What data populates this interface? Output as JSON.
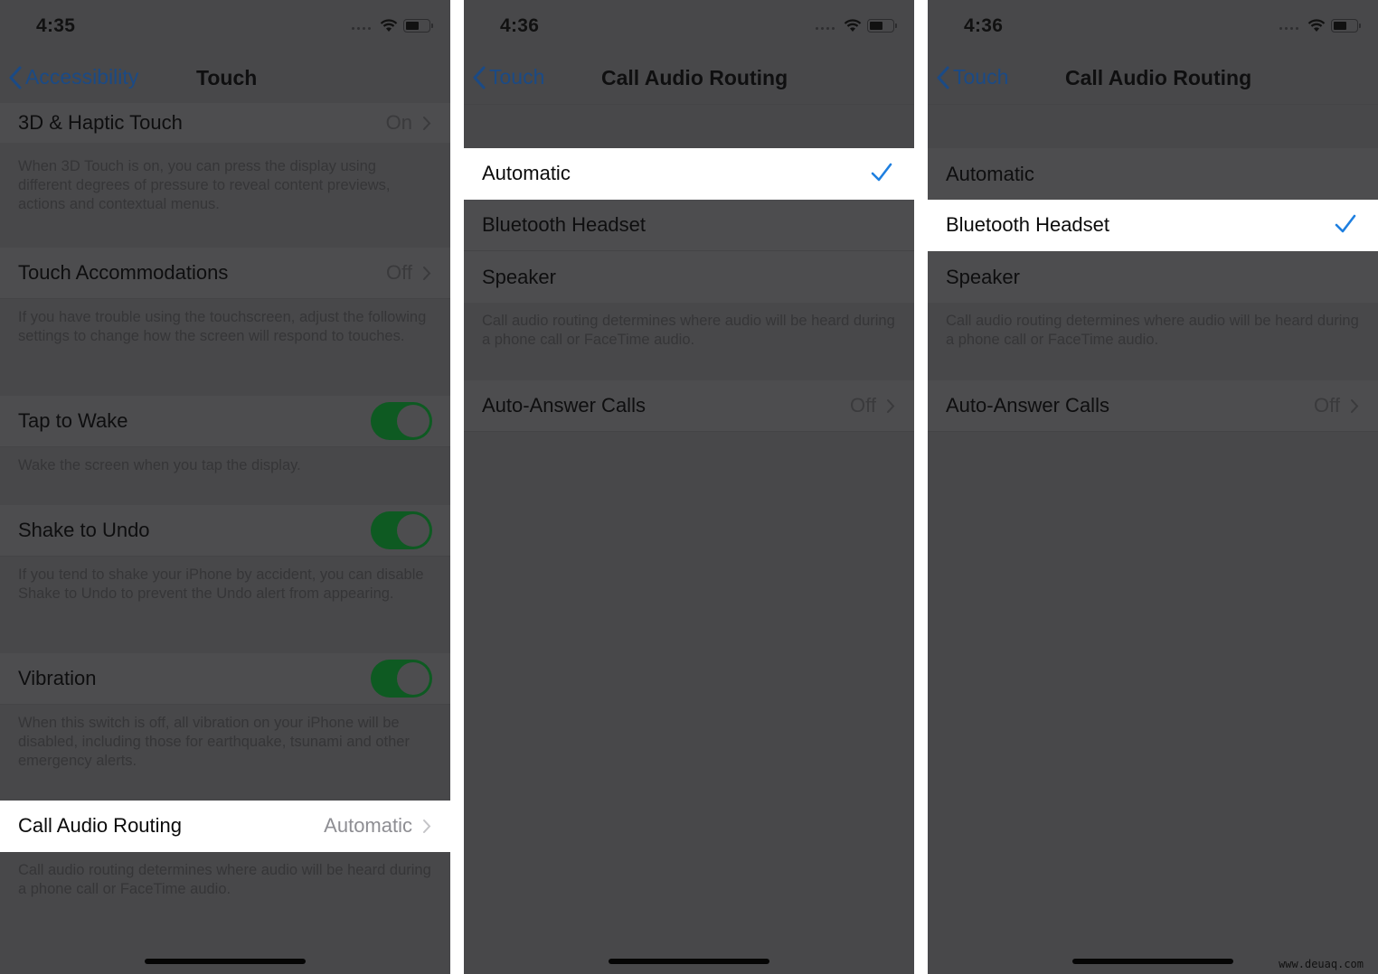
{
  "colors": {
    "accent_blue": "#1b4a85",
    "checkmark_blue": "#1e7fe0",
    "toggle_on": "#0e5a22",
    "highlight_row": "#ffffff",
    "dimmed_background": "#48484a"
  },
  "screens": [
    {
      "status": {
        "time": "4:35",
        "wifi_icon": "wifi-icon",
        "battery_icon": "battery-icon"
      },
      "nav": {
        "back_label": "Accessibility",
        "title": "Touch"
      },
      "rows": [
        {
          "label": "3D & Haptic Touch",
          "value": "On",
          "footer": "When 3D Touch is on, you can press the display using different degrees of pressure to reveal content previews, actions and contextual menus."
        },
        {
          "label": "Touch Accommodations",
          "value": "Off",
          "footer": "If you have trouble using the touchscreen, adjust the following settings to change how the screen will respond to touches."
        },
        {
          "label": "Tap to Wake",
          "toggle": "on",
          "footer": "Wake the screen when you tap the display."
        },
        {
          "label": "Shake to Undo",
          "toggle": "on",
          "footer": "If you tend to shake your iPhone by accident, you can disable Shake to Undo to prevent the Undo alert from appearing."
        },
        {
          "label": "Vibration",
          "toggle": "on",
          "footer": "When this switch is off, all vibration on your iPhone will be disabled, including those for earthquake, tsunami and other emergency alerts."
        },
        {
          "label": "Call Audio Routing",
          "value": "Automatic",
          "highlighted": true,
          "footer": "Call audio routing determines where audio will be heard during a phone call or FaceTime audio."
        }
      ]
    },
    {
      "status": {
        "time": "4:36"
      },
      "nav": {
        "back_label": "Touch",
        "title": "Call Audio Routing"
      },
      "options": [
        {
          "label": "Automatic",
          "selected": true
        },
        {
          "label": "Bluetooth Headset",
          "selected": false
        },
        {
          "label": "Speaker",
          "selected": false
        }
      ],
      "options_footer": "Call audio routing determines where audio will be heard during a phone call or FaceTime audio.",
      "auto_answer": {
        "label": "Auto-Answer Calls",
        "value": "Off"
      }
    },
    {
      "status": {
        "time": "4:36"
      },
      "nav": {
        "back_label": "Touch",
        "title": "Call Audio Routing"
      },
      "options": [
        {
          "label": "Automatic",
          "selected": false
        },
        {
          "label": "Bluetooth Headset",
          "selected": true
        },
        {
          "label": "Speaker",
          "selected": false
        }
      ],
      "options_footer": "Call audio routing determines where audio will be heard during a phone call or FaceTime audio.",
      "auto_answer": {
        "label": "Auto-Answer Calls",
        "value": "Off"
      }
    }
  ],
  "watermark": "www.deuaq.com"
}
